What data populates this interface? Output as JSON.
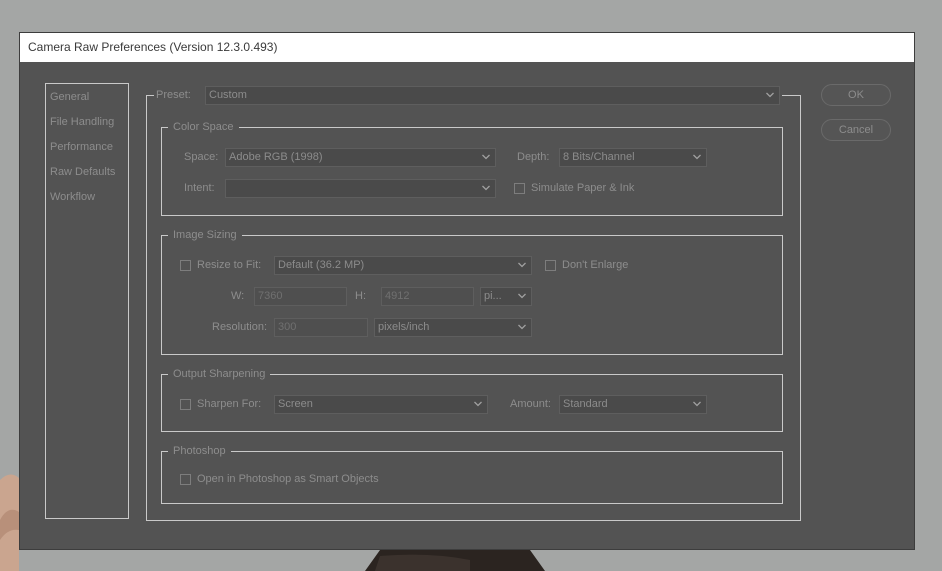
{
  "window": {
    "title": "Camera Raw Preferences  (Version 12.3.0.493)"
  },
  "nav": {
    "items": [
      "General",
      "File Handling",
      "Performance",
      "Raw Defaults",
      "Workflow"
    ]
  },
  "preset": {
    "label": "Preset:",
    "value": "Custom"
  },
  "buttons": {
    "ok": "OK",
    "cancel": "Cancel"
  },
  "color_space": {
    "legend": "Color Space",
    "space_label": "Space:",
    "space_value": "Adobe RGB (1998)",
    "depth_label": "Depth:",
    "depth_value": "8 Bits/Channel",
    "intent_label": "Intent:",
    "intent_value": "",
    "simulate_label": "Simulate Paper & Ink"
  },
  "image_sizing": {
    "legend": "Image Sizing",
    "resize_label": "Resize to Fit:",
    "resize_value": "Default  (36.2 MP)",
    "dont_enlarge_label": "Don't Enlarge",
    "w_label": "W:",
    "w_value": "7360",
    "h_label": "H:",
    "h_value": "4912",
    "unit_value": "pi...",
    "resolution_label": "Resolution:",
    "resolution_value": "300",
    "resolution_unit": "pixels/inch"
  },
  "output_sharpening": {
    "legend": "Output Sharpening",
    "sharpen_label": "Sharpen For:",
    "sharpen_value": "Screen",
    "amount_label": "Amount:",
    "amount_value": "Standard"
  },
  "photoshop": {
    "legend": "Photoshop",
    "smart_objects_label": "Open in Photoshop as Smart Objects"
  }
}
